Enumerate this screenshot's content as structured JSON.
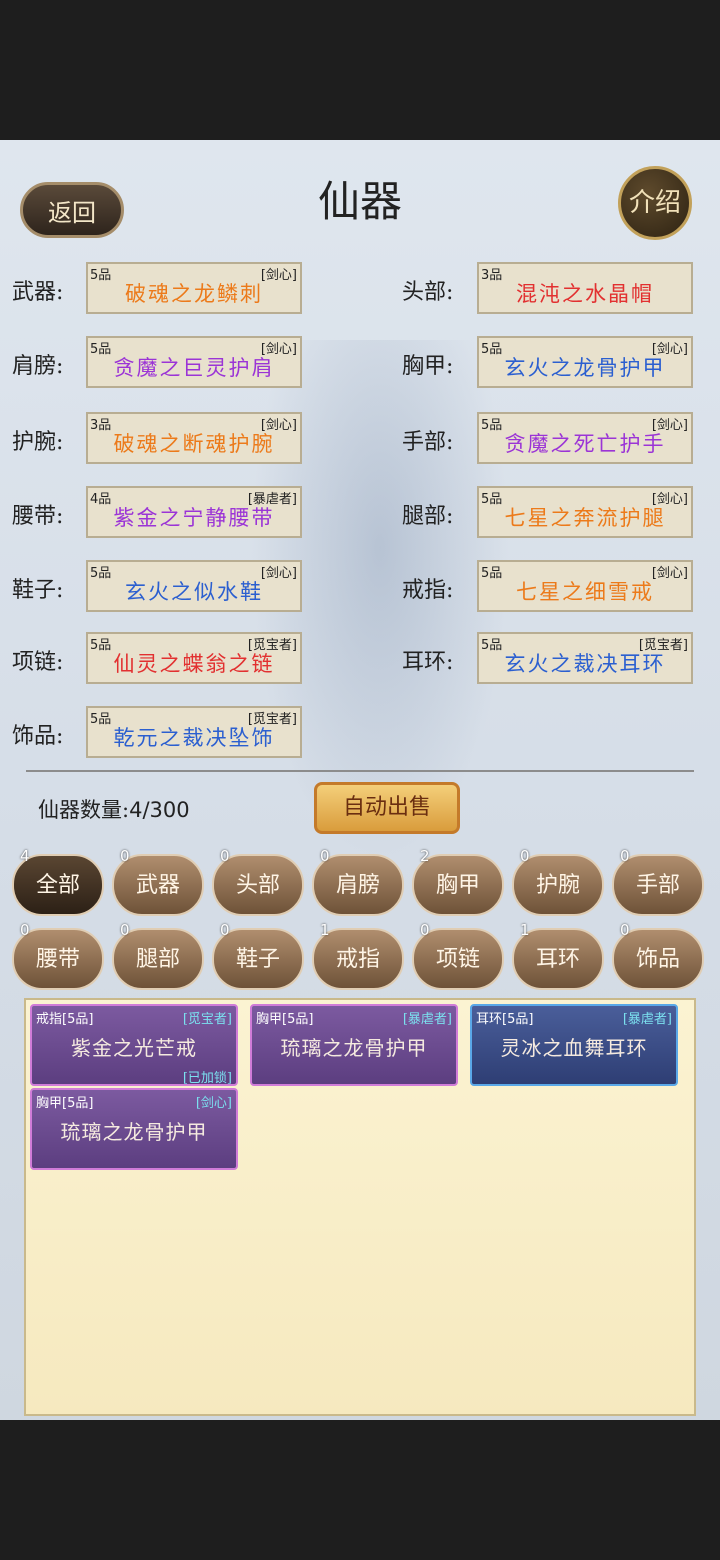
{
  "title": "仙器",
  "back_label": "返回",
  "intro_label": "介绍",
  "colors": {
    "orange": "#ec7a1a",
    "purple": "#9b34d6",
    "red": "#e23030",
    "blue": "#2b5fd0"
  },
  "slots": [
    {
      "label": "武器:",
      "grade": "5品",
      "tag": "[剑心]",
      "name": "破魂之龙鳞刺",
      "color": "#ec7a1a"
    },
    {
      "label": "头部:",
      "grade": "3品",
      "tag": "",
      "name": "混沌之水晶帽",
      "color": "#e23030"
    },
    {
      "label": "肩膀:",
      "grade": "5品",
      "tag": "[剑心]",
      "name": "贪魔之巨灵护肩",
      "color": "#9b34d6"
    },
    {
      "label": "胸甲:",
      "grade": "5品",
      "tag": "[剑心]",
      "name": "玄火之龙骨护甲",
      "color": "#2b5fd0"
    },
    {
      "label": "护腕:",
      "grade": "3品",
      "tag": "[剑心]",
      "name": "破魂之断魂护腕",
      "color": "#ec7a1a"
    },
    {
      "label": "手部:",
      "grade": "5品",
      "tag": "[剑心]",
      "name": "贪魔之死亡护手",
      "color": "#9b34d6"
    },
    {
      "label": "腰带:",
      "grade": "4品",
      "tag": "[暴虐者]",
      "name": "紫金之宁静腰带",
      "color": "#9b34d6"
    },
    {
      "label": "腿部:",
      "grade": "5品",
      "tag": "[剑心]",
      "name": "七星之奔流护腿",
      "color": "#ec7a1a"
    },
    {
      "label": "鞋子:",
      "grade": "5品",
      "tag": "[剑心]",
      "name": "玄火之似水鞋",
      "color": "#2b5fd0"
    },
    {
      "label": "戒指:",
      "grade": "5品",
      "tag": "[剑心]",
      "name": "七星之细雪戒",
      "color": "#ec7a1a"
    },
    {
      "label": "项链:",
      "grade": "5品",
      "tag": "[觅宝者]",
      "name": "仙灵之蝶翁之链",
      "color": "#e23030"
    },
    {
      "label": "耳环:",
      "grade": "5品",
      "tag": "[觅宝者]",
      "name": "玄火之裁决耳环",
      "color": "#2b5fd0"
    },
    {
      "label": "饰品:",
      "grade": "5品",
      "tag": "[觅宝者]",
      "name": "乾元之裁决坠饰",
      "color": "#2b5fd0"
    }
  ],
  "count_label": "仙器数量:",
  "count_value": "4/300",
  "auto_sell_label": "自动出售",
  "tabs": [
    {
      "label": "全部",
      "count": "4",
      "active": true
    },
    {
      "label": "武器",
      "count": "0"
    },
    {
      "label": "头部",
      "count": "0"
    },
    {
      "label": "肩膀",
      "count": "0"
    },
    {
      "label": "胸甲",
      "count": "2"
    },
    {
      "label": "护腕",
      "count": "0"
    },
    {
      "label": "手部",
      "count": "0"
    },
    {
      "label": "腰带",
      "count": "0"
    },
    {
      "label": "腿部",
      "count": "0"
    },
    {
      "label": "鞋子",
      "count": "0"
    },
    {
      "label": "戒指",
      "count": "1"
    },
    {
      "label": "项链",
      "count": "0"
    },
    {
      "label": "耳环",
      "count": "1"
    },
    {
      "label": "饰品",
      "count": "0"
    }
  ],
  "inventory": [
    {
      "type": "戒指[5品]",
      "tag": "[觅宝者]",
      "name": "紫金之光芒戒",
      "status": "[已加锁]",
      "style": "purple"
    },
    {
      "type": "胸甲[5品]",
      "tag": "[暴虐者]",
      "name": "琉璃之龙骨护甲",
      "status": "",
      "style": "purple"
    },
    {
      "type": "耳环[5品]",
      "tag": "[暴虐者]",
      "name": "灵冰之血舞耳环",
      "status": "",
      "style": "blue"
    },
    {
      "type": "胸甲[5品]",
      "tag": "[剑心]",
      "name": "琉璃之龙骨护甲",
      "status": "",
      "style": "purple"
    }
  ]
}
